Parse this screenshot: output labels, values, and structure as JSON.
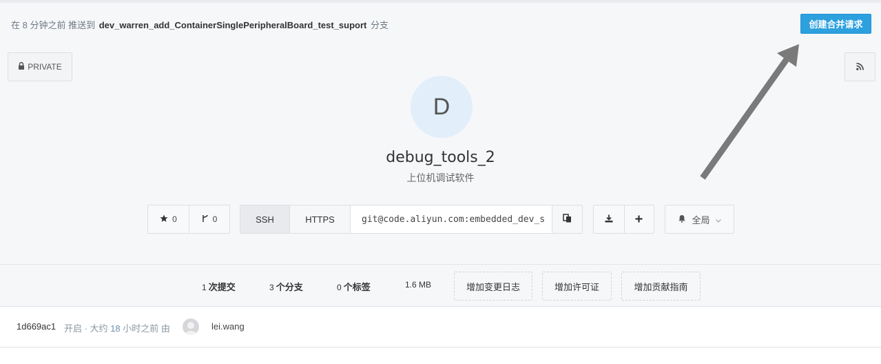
{
  "notice": {
    "prefix": "在 8 分钟之前 推送到",
    "branch": "dev_warren_add_ContainerSinglePeripheralBoard_test_suport",
    "suffix": "分支"
  },
  "actions": {
    "create_merge_request": "创建合并请求"
  },
  "visibility": {
    "label": "PRIVATE"
  },
  "repo": {
    "avatar_letter": "D",
    "name": "debug_tools_2",
    "description": "上位机调试软件"
  },
  "counters": {
    "stars": "0",
    "forks": "0"
  },
  "clone": {
    "ssh_label": "SSH",
    "https_label": "HTTPS",
    "url": "git@code.aliyun.com:embedded_dev_s"
  },
  "watch": {
    "label": "全局"
  },
  "stats": {
    "commits_num": "1",
    "commits_label": "次提交",
    "branches_num": "3",
    "branches_label": "个分支",
    "tags_num": "0",
    "tags_label": "个标签",
    "size": "1.6 MB",
    "add_changelog": "增加变更日志",
    "add_license": "增加许可证",
    "add_contributing": "增加贡献指南"
  },
  "last_commit": {
    "hash": "1d669ac1",
    "meta_prefix": "开启 · 大约",
    "hours": "18",
    "meta_suffix": "小时之前 由",
    "author": "lei.wang"
  },
  "icons": {
    "lock": "lock-icon",
    "rss": "rss-icon",
    "star": "star-icon",
    "fork": "fork-icon",
    "copy": "clipboard-icon",
    "download": "download-icon",
    "plus": "plus-icon",
    "bell": "bell-icon",
    "chevron": "chevron-down-icon"
  },
  "colors": {
    "accent": "#2da0de",
    "annotation_arrow": "#7a7a7a"
  }
}
